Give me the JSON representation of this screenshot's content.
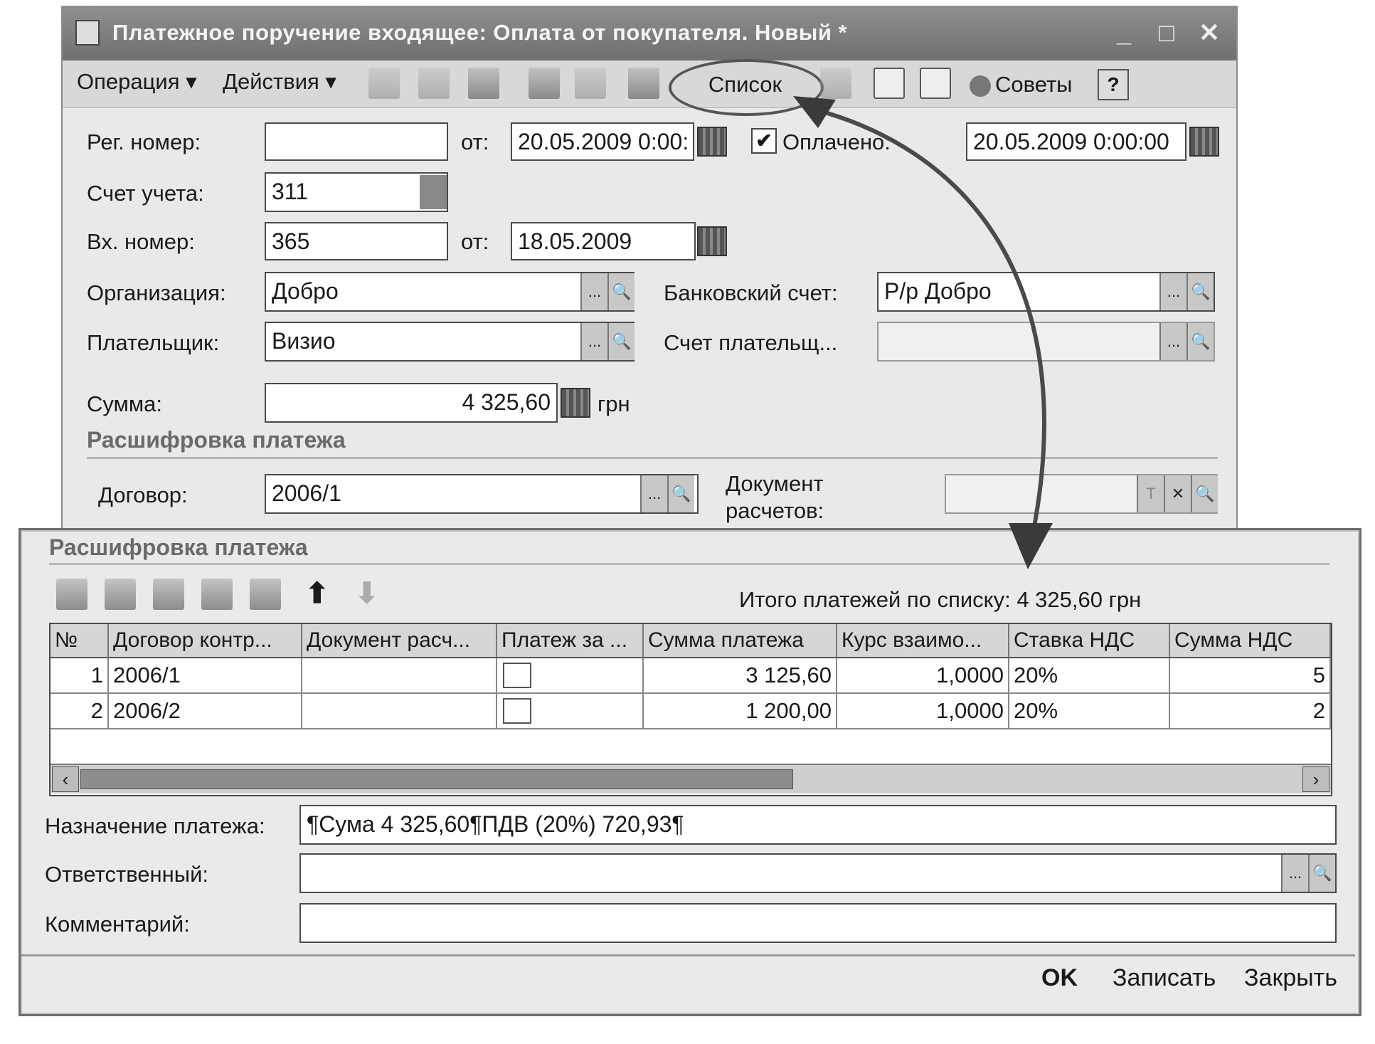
{
  "window": {
    "title": "Платежное поручение входящее: Оплата от покупателя. Новый *",
    "minimize": "_",
    "maximize": "□",
    "close": "✕"
  },
  "menu": {
    "operation": "Операция ▾",
    "actions": "Действия ▾",
    "list_button": "Список",
    "tips_button": "Советы",
    "help_button": "?"
  },
  "form": {
    "reg_number_label": "Рег. номер:",
    "reg_number_value": "",
    "from_label_1": "от:",
    "date_1": "20.05.2009  0:00:",
    "paid_label": "Оплачено:",
    "paid_checked": "✔",
    "paid_date": "20.05.2009  0:00:00",
    "account_label": "Счет учета:",
    "account_value": "311",
    "incoming_number_label": "Вх. номер:",
    "incoming_number_value": "365",
    "from_label_2": "от:",
    "date_2": "18.05.2009",
    "organization_label": "Организация:",
    "organization_value": "Добро",
    "bank_account_label": "Банковский счет:",
    "bank_account_value": "Р/р Добро",
    "payer_label": "Плательщик:",
    "payer_value": "Визио",
    "payer_account_label": "Счет плательщ...",
    "payer_account_value": "",
    "sum_label": "Сумма:",
    "sum_value": "4 325,60",
    "currency": "грн",
    "section_title": "Расшифровка платежа",
    "contract_label": "Договор:",
    "contract_value": "2006/1",
    "settlement_doc_label_1": "Документ",
    "settlement_doc_label_2": "расчетов:",
    "settlement_doc_value": ""
  },
  "details": {
    "section_title": "Расшифровка платежа",
    "total_text": "Итого платежей по списку: 4 325,60 грн",
    "columns": [
      "№",
      "Договор контр...",
      "Документ расч...",
      "Платеж за ...",
      "Сумма платежа",
      "Курс взаимо...",
      "Ставка НДС",
      "Сумма НДС"
    ],
    "rows": [
      {
        "n": "1",
        "contract": "2006/1",
        "doc": "",
        "sum": "3 125,60",
        "rate": "1,0000",
        "vat": "20%",
        "vat_sum": "5"
      },
      {
        "n": "2",
        "contract": "2006/2",
        "doc": "",
        "sum": "1 200,00",
        "rate": "1,0000",
        "vat": "20%",
        "vat_sum": "2"
      }
    ],
    "purpose_label": "Назначение платежа:",
    "purpose_value": "¶Сума 4 325,60¶ПДВ (20%) 720,93¶",
    "responsible_label": "Ответственный:",
    "responsible_value": "",
    "comment_label": "Комментарий:",
    "comment_value": ""
  },
  "footer": {
    "ok": "OK",
    "save": "Записать",
    "close": "Закрыть"
  }
}
